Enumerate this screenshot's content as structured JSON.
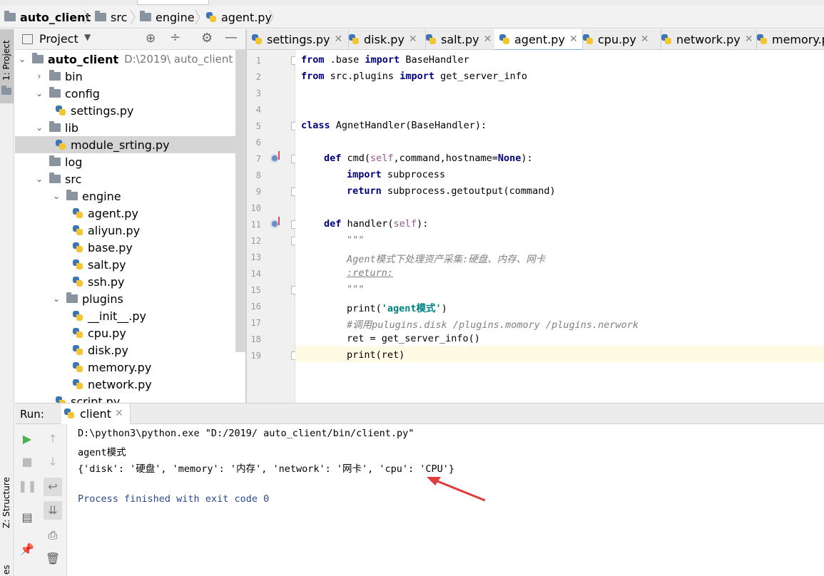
{
  "breadcrumb": {
    "project": "auto_client",
    "folder1": "src",
    "folder2": "engine",
    "file": "agent.py"
  },
  "left_strip": {
    "project_tab": "1: Project",
    "structure_tab": "Z: Structure",
    "bottom_tab": "es"
  },
  "project_panel": {
    "title": "Project",
    "tree": [
      {
        "label": "auto_client",
        "path": "D:\\2019\\ auto_client",
        "type": "root"
      },
      {
        "label": "bin",
        "type": "folder"
      },
      {
        "label": "config",
        "type": "folder"
      },
      {
        "label": "settings.py",
        "type": "file"
      },
      {
        "label": "lib",
        "type": "folder"
      },
      {
        "label": "module_srting.py",
        "type": "file"
      },
      {
        "label": "log",
        "type": "folder"
      },
      {
        "label": "src",
        "type": "folder"
      },
      {
        "label": "engine",
        "type": "folder"
      },
      {
        "label": "agent.py",
        "type": "file"
      },
      {
        "label": "aliyun.py",
        "type": "file"
      },
      {
        "label": "base.py",
        "type": "file"
      },
      {
        "label": "salt.py",
        "type": "file"
      },
      {
        "label": "ssh.py",
        "type": "file"
      },
      {
        "label": "plugins",
        "type": "folder"
      },
      {
        "label": "__init__.py",
        "type": "file"
      },
      {
        "label": "cpu.py",
        "type": "file"
      },
      {
        "label": "disk.py",
        "type": "file"
      },
      {
        "label": "memory.py",
        "type": "file"
      },
      {
        "label": "network.py",
        "type": "file"
      },
      {
        "label": "script.py",
        "type": "file"
      }
    ]
  },
  "editor": {
    "tabs": [
      "settings.py",
      "disk.py",
      "salt.py",
      "agent.py",
      "cpu.py",
      "network.py",
      "memory.p"
    ],
    "active_tab": "agent.py",
    "line_numbers": [
      "1",
      "2",
      "3",
      "4",
      "5",
      "6",
      "7",
      "8",
      "9",
      "10",
      "11",
      "12",
      "13",
      "14",
      "15",
      "16",
      "17",
      "18",
      "19"
    ],
    "code": {
      "l1_kw1": "from",
      "l1_mid": " .base ",
      "l1_kw2": "import",
      "l1_end": " BaseHandler",
      "l2_kw1": "from",
      "l2_mid": " src.plugins ",
      "l2_kw2": "import",
      "l2_end": " get_server_info",
      "l5_kw": "class",
      "l5_rest": " AgnetHandler(BaseHandler):",
      "l7_kw": "def",
      "l7_a": " cmd(",
      "l7_self": "self",
      "l7_b": ",command,hostname=",
      "l7_none": "None",
      "l7_c": "):",
      "l8_kw": "import",
      "l8_rest": " subprocess",
      "l9_kw": "return",
      "l9_rest": " subprocess.getoutput(command)",
      "l11_kw": "def",
      "l11_a": " handler(",
      "l11_self": "self",
      "l11_b": "):",
      "l12": "\"\"\"",
      "l13": "Agent模式下处理资产采集:硬盘、内存、网卡",
      "l14": ":return:",
      "l15": "\"\"\"",
      "l16_a": "print(",
      "l16_str": "'agent模式'",
      "l16_b": ")",
      "l17": "#调用pulugins.disk /plugins.momory /plugins.nerwork",
      "l18": "ret = get_server_info()",
      "l19": "print(ret)"
    }
  },
  "run_panel": {
    "label": "Run:",
    "tab": "client",
    "output": [
      "D:\\python3\\python.exe \"D:/2019/ auto_client/bin/client.py\"",
      "agent模式",
      "{'disk': '硬盘', 'memory': '内存', 'network': '网卡', 'cpu': 'CPU'}",
      "",
      "Process finished with exit code 0"
    ]
  },
  "colors": {
    "keyword": "#000080",
    "string": "#008080",
    "self": "#94558d",
    "comment": "#808080",
    "process_text": "#2b4a8f",
    "annotation_arrow": "#e23b3b",
    "run_green": "#4caf50"
  }
}
